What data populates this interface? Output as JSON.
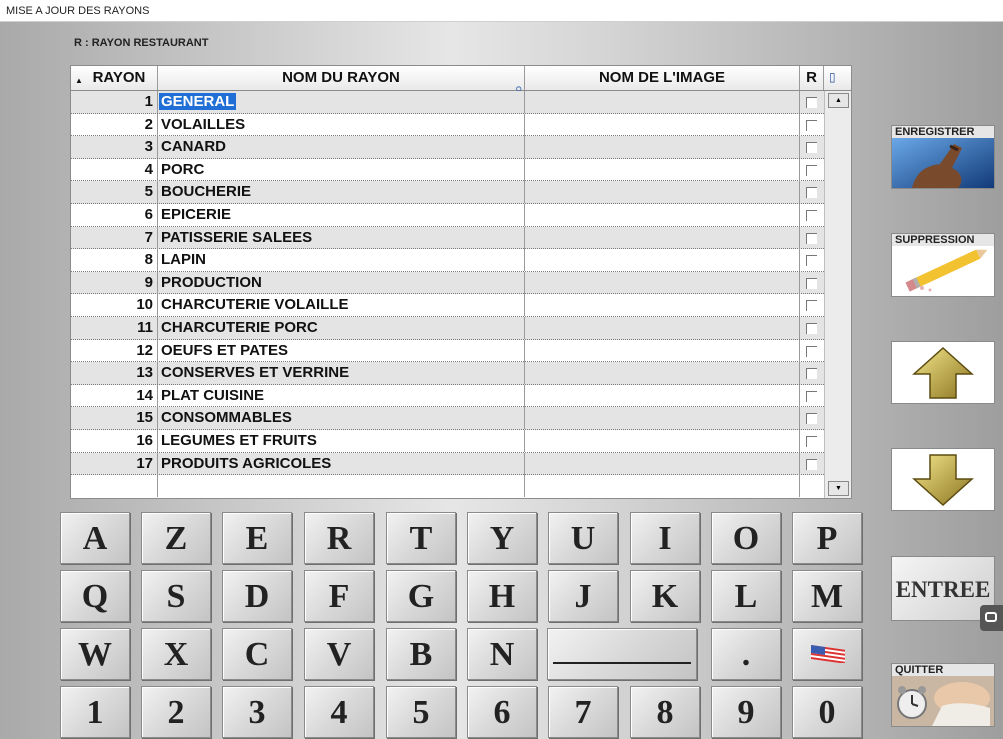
{
  "window": {
    "title": "MISE A JOUR DES RAYONS"
  },
  "subtitle": "R : RAYON RESTAURANT",
  "table": {
    "columns": [
      "RAYON",
      "NOM DU RAYON",
      "NOM DE L'IMAGE",
      "R"
    ],
    "rows": [
      {
        "num": "1",
        "name": "GENERAL",
        "image": "",
        "r": false,
        "selected": true
      },
      {
        "num": "2",
        "name": "VOLAILLES",
        "image": "",
        "r": false
      },
      {
        "num": "3",
        "name": "CANARD",
        "image": "",
        "r": false
      },
      {
        "num": "4",
        "name": "PORC",
        "image": "",
        "r": false
      },
      {
        "num": "5",
        "name": "BOUCHERIE",
        "image": "",
        "r": false
      },
      {
        "num": "6",
        "name": "EPICERIE",
        "image": "",
        "r": false
      },
      {
        "num": "7",
        "name": "PATISSERIE SALEES",
        "image": "",
        "r": false
      },
      {
        "num": "8",
        "name": "LAPIN",
        "image": "",
        "r": false
      },
      {
        "num": "9",
        "name": "PRODUCTION",
        "image": "",
        "r": false
      },
      {
        "num": "10",
        "name": "CHARCUTERIE VOLAILLE",
        "image": "",
        "r": false
      },
      {
        "num": "11",
        "name": "CHARCUTERIE PORC",
        "image": "",
        "r": false
      },
      {
        "num": "12",
        "name": "OEUFS ET PATES",
        "image": "",
        "r": false
      },
      {
        "num": "13",
        "name": "CONSERVES ET VERRINE",
        "image": "",
        "r": false
      },
      {
        "num": "14",
        "name": "PLAT CUISINE",
        "image": "",
        "r": false
      },
      {
        "num": "15",
        "name": "CONSOMMABLES",
        "image": "",
        "r": false
      },
      {
        "num": "16",
        "name": "LEGUMES ET FRUITS",
        "image": "",
        "r": false
      },
      {
        "num": "17",
        "name": "PRODUITS AGRICOLES",
        "image": "",
        "r": false
      }
    ]
  },
  "keyboard": {
    "row1": [
      "A",
      "Z",
      "E",
      "R",
      "T",
      "Y",
      "U",
      "I",
      "O",
      "P"
    ],
    "row2": [
      "Q",
      "S",
      "D",
      "F",
      "G",
      "H",
      "J",
      "K",
      "L",
      "M"
    ],
    "row3": [
      "W",
      "X",
      "C",
      "V",
      "B",
      "N"
    ],
    "row3_after_space": ".",
    "row4": [
      "1",
      "2",
      "3",
      "4",
      "5",
      "6",
      "7",
      "8",
      "9",
      "0"
    ]
  },
  "side_buttons": {
    "enregistrer": "ENREGISTRER",
    "suppression": "SUPPRESSION",
    "entree": "ENTREE",
    "quitter": "QUITTER"
  },
  "icons": {
    "up": "arrow-up-icon",
    "down": "arrow-down-icon",
    "flag": "flag-icon"
  }
}
